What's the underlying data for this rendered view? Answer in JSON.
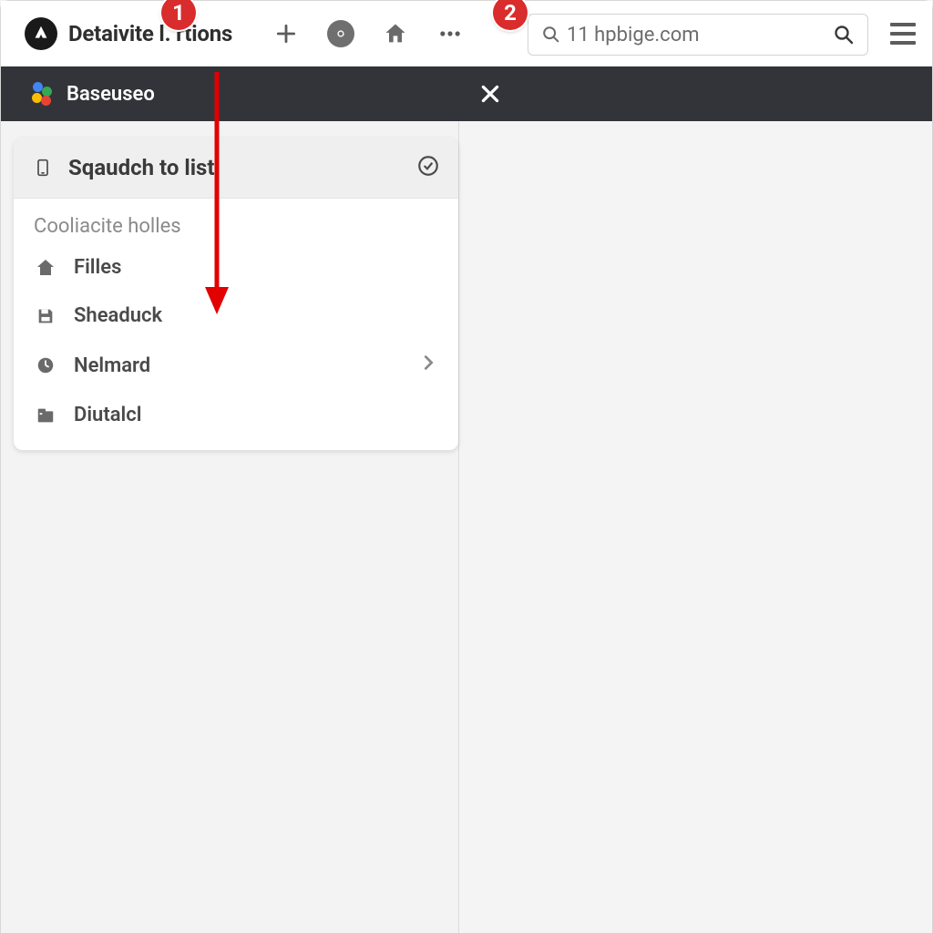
{
  "tab": {
    "title": "Detaivite l.   rtions"
  },
  "addressbar": {
    "url": "11 hpbige.com",
    "placeholder": ""
  },
  "darkbar": {
    "brand": "Baseuseo"
  },
  "panel": {
    "head_title": "Sqaudch to list",
    "subtitle": "Cooliacite holles",
    "items": [
      {
        "label": "Filles"
      },
      {
        "label": "Sheaduck"
      },
      {
        "label": "Nelmard"
      },
      {
        "label": "Diutalcl"
      }
    ]
  },
  "step_badges": {
    "one": "1",
    "two": "2"
  }
}
